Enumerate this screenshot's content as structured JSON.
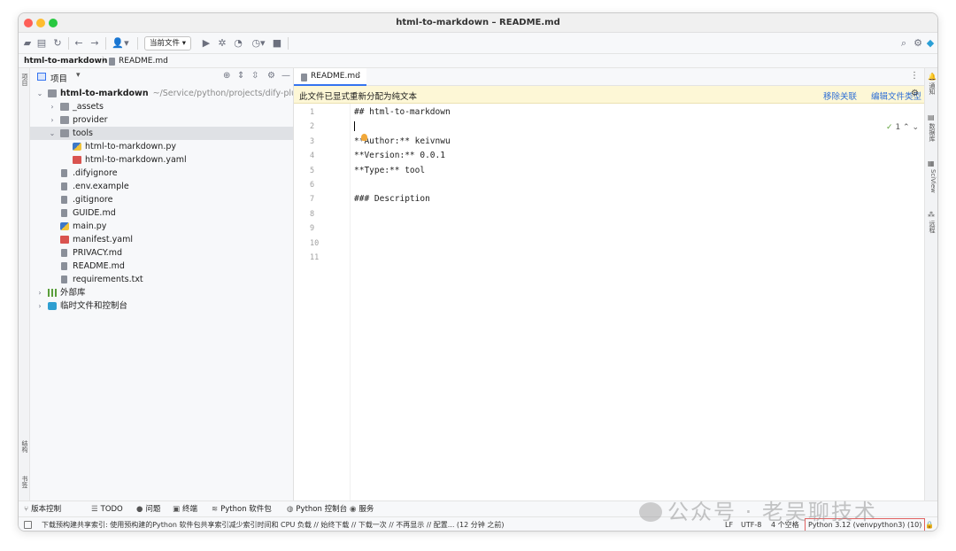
{
  "window": {
    "title": "html-to-markdown – README.md"
  },
  "toolbar": {
    "current_file_dropdown": "当前文件 ▾"
  },
  "breadcrumb": {
    "project": "html-to-markdown",
    "separator": "〉",
    "file": "README.md"
  },
  "left_stripe": {
    "project": "项目",
    "structure": "结构",
    "bookmarks": "书签"
  },
  "project_panel": {
    "title": "项目",
    "dropdown": "▾",
    "tree": [
      {
        "label": "html-to-markdown",
        "path": "~/Service/python/projects/dify-plugin/",
        "icon": "folder-icon",
        "arrow": "⌄",
        "bold": true
      },
      {
        "label": "_assets",
        "icon": "folder-icon",
        "arrow": "›"
      },
      {
        "label": "provider",
        "icon": "folder-icon",
        "arrow": "›"
      },
      {
        "label": "tools",
        "icon": "folder-icon",
        "arrow": "⌄",
        "selected": true
      },
      {
        "label": "html-to-markdown.py",
        "icon": "python-file-icon"
      },
      {
        "label": "html-to-markdown.yaml",
        "icon": "yaml-file-icon"
      },
      {
        "label": ".difyignore",
        "icon": "text-file-icon"
      },
      {
        "label": ".env.example",
        "icon": "text-file-icon"
      },
      {
        "label": ".gitignore",
        "icon": "gitignore-file-icon"
      },
      {
        "label": "GUIDE.md",
        "icon": "markdown-file-icon"
      },
      {
        "label": "main.py",
        "icon": "python-file-icon"
      },
      {
        "label": "manifest.yaml",
        "icon": "yaml-file-icon"
      },
      {
        "label": "PRIVACY.md",
        "icon": "markdown-file-icon"
      },
      {
        "label": "README.md",
        "icon": "markdown-file-icon"
      },
      {
        "label": "requirements.txt",
        "icon": "text-file-icon"
      },
      {
        "label": "外部库",
        "icon": "library-icon",
        "arrow": "›"
      },
      {
        "label": "临时文件和控制台",
        "icon": "scratch-icon",
        "arrow": "›"
      }
    ]
  },
  "editor": {
    "tab": {
      "label": "README.md",
      "close": "×"
    },
    "banner": {
      "message": "此文件已显式重新分配为纯文本",
      "remove_link": "移除关联",
      "edit_type_link": "编辑文件类型"
    },
    "inspection": {
      "check": "✓",
      "count": "1",
      "nav": "⌃ ⌄"
    },
    "line_numbers": [
      "1",
      "2",
      "3",
      "4",
      "5",
      "6",
      "7",
      "8",
      "9",
      "10",
      "11"
    ],
    "lines": [
      "## html-to-markdown",
      "",
      "**Author:** keivnwu",
      "**Version:** 0.0.1",
      "**Type:** tool",
      "",
      "### Description",
      "",
      "",
      "",
      ""
    ]
  },
  "right_stripe": {
    "notifications": "通知",
    "database": "数据库",
    "sciview": "SciView",
    "remote": "远程"
  },
  "tool_windows": [
    {
      "label": "版本控制",
      "icon": "branch-icon"
    },
    {
      "label": "TODO",
      "icon": "list-icon"
    },
    {
      "label": "问题",
      "icon": "problems-icon"
    },
    {
      "label": "终端",
      "icon": "terminal-icon"
    },
    {
      "label": "Python 软件包",
      "icon": "layers-icon"
    },
    {
      "label": "Python 控制台",
      "icon": "python-console-icon"
    },
    {
      "label": "服务",
      "icon": "services-icon"
    }
  ],
  "status": {
    "message": "下载预构建共享索引: 使用预构建的Python 软件包共享索引减少索引时间和 CPU 负载 // 始终下载 // 下载一次 // 不再显示 // 配置... (12 分钟 之前)",
    "line_sep": "LF",
    "encoding": "UTF-8",
    "indent": "4 个空格",
    "interpreter": "Python 3.12 (venvpython3) (10)"
  },
  "watermark": {
    "text": "公众号 · 老吴聊技术"
  }
}
